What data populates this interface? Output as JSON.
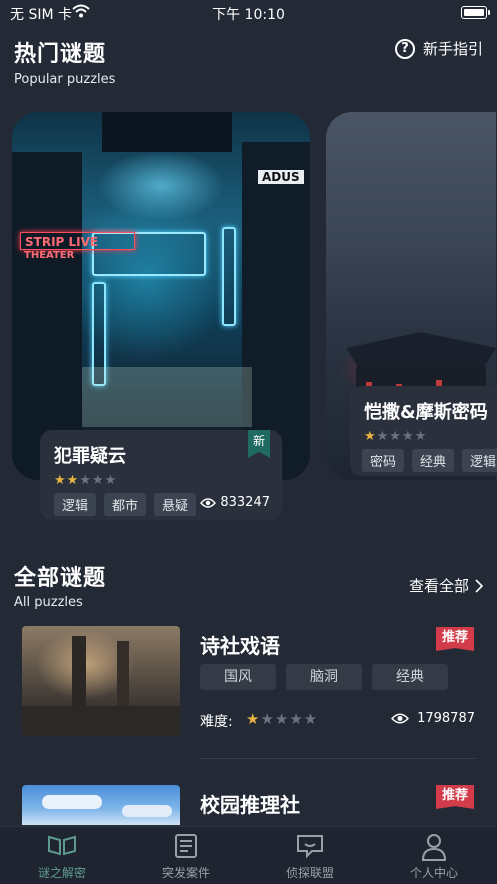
{
  "status_bar": {
    "carrier": "无 SIM 卡",
    "time": "下午 10:10"
  },
  "header": {
    "title": "热门谜题",
    "subtitle": "Popular puzzles",
    "guide_label": "新手指引"
  },
  "featured": [
    {
      "name": "犯罪疑云",
      "rating": 2,
      "max_rating": 5,
      "tags": [
        "逻辑",
        "都市",
        "悬疑"
      ],
      "views": "833247",
      "badge": "新",
      "sign_text": "STRIP LIVE",
      "sign_sub": "THEATER",
      "sign2": "ADUS"
    },
    {
      "name": "恺撒&摩斯密码",
      "rating": 1,
      "max_rating": 5,
      "tags": [
        "密码",
        "经典",
        "逻辑"
      ]
    }
  ],
  "all_section": {
    "title": "全部谜题",
    "subtitle": "All puzzles",
    "more_label": "查看全部"
  },
  "puzzles": [
    {
      "name": "诗社戏语",
      "badge": "推荐",
      "tags": [
        "国风",
        "脑洞",
        "经典"
      ],
      "difficulty_label": "难度:",
      "rating": 1,
      "max_rating": 5,
      "views": "1798787"
    },
    {
      "name": "校园推理社",
      "badge": "推荐"
    }
  ],
  "tabs": [
    {
      "label": "谜之解密",
      "icon": "book-icon",
      "active": true
    },
    {
      "label": "突发案件",
      "icon": "newspaper-icon",
      "active": false
    },
    {
      "label": "侦探联盟",
      "icon": "chat-icon",
      "active": false
    },
    {
      "label": "个人中心",
      "icon": "person-icon",
      "active": false
    }
  ],
  "colors": {
    "background": "#232a36",
    "star": "#e9b443",
    "badge_red": "#d23c4a",
    "ribbon_green": "#1f6a62",
    "tab_active": "#5f9a92"
  }
}
